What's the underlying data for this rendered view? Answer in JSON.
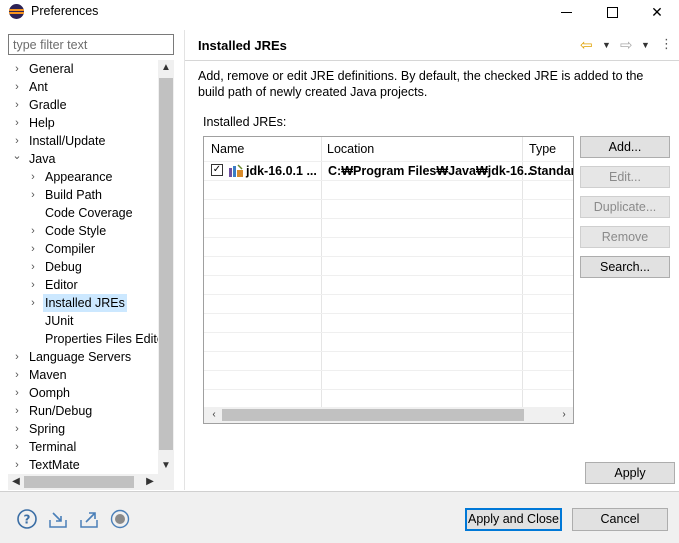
{
  "window": {
    "title": "Preferences",
    "minimize": "",
    "maximize": "",
    "close": "✕"
  },
  "sidebar": {
    "filter_placeholder": "type filter text",
    "items": [
      {
        "label": "General",
        "expander": "›"
      },
      {
        "label": "Ant",
        "expander": "›"
      },
      {
        "label": "Gradle",
        "expander": "›"
      },
      {
        "label": "Help",
        "expander": "›"
      },
      {
        "label": "Install/Update",
        "expander": "›"
      },
      {
        "label": "Java",
        "expander": "⌄"
      },
      {
        "label": "Appearance",
        "expander": "›"
      },
      {
        "label": "Build Path",
        "expander": "›"
      },
      {
        "label": "Code Coverage",
        "expander": ""
      },
      {
        "label": "Code Style",
        "expander": "›"
      },
      {
        "label": "Compiler",
        "expander": "›"
      },
      {
        "label": "Debug",
        "expander": "›"
      },
      {
        "label": "Editor",
        "expander": "›"
      },
      {
        "label": "Installed JREs",
        "expander": "›"
      },
      {
        "label": "JUnit",
        "expander": ""
      },
      {
        "label": "Properties Files Editor",
        "expander": ""
      },
      {
        "label": "Language Servers",
        "expander": "›"
      },
      {
        "label": "Maven",
        "expander": "›"
      },
      {
        "label": "Oomph",
        "expander": "›"
      },
      {
        "label": "Run/Debug",
        "expander": "›"
      },
      {
        "label": "Spring",
        "expander": "›"
      },
      {
        "label": "Terminal",
        "expander": "›"
      },
      {
        "label": "TextMate",
        "expander": "›"
      }
    ]
  },
  "page": {
    "title": "Installed JREs",
    "description": "Add, remove or edit JRE definitions. By default, the checked JRE is added to the build path of newly created Java projects.",
    "list_label": "Installed JREs:",
    "columns": [
      "Name",
      "Location",
      "Type"
    ],
    "jres": [
      {
        "checked": true,
        "name": "jdk-16.0.1 ...",
        "location": "C:₩Program Files₩Java₩jdk-16...",
        "type": "Standar"
      }
    ],
    "buttons": {
      "add": "Add...",
      "edit": "Edit...",
      "duplicate": "Duplicate...",
      "remove": "Remove",
      "search": "Search..."
    },
    "apply": "Apply"
  },
  "footer": {
    "apply_close": "Apply and Close",
    "cancel": "Cancel"
  },
  "colors": {
    "selection": "#cce8ff",
    "focus_border": "#0078d7",
    "nav_back": "#e0a100"
  }
}
